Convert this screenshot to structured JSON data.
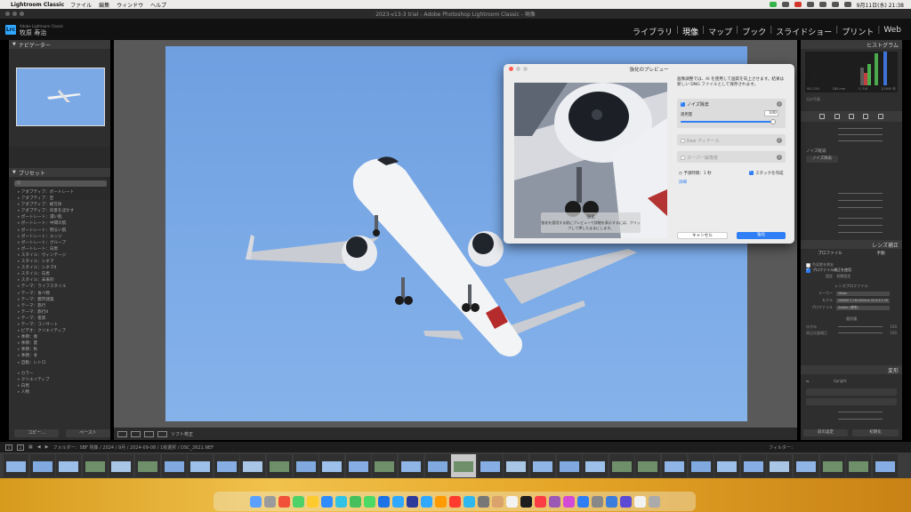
{
  "menubar": {
    "app_name": "Lightroom Classic",
    "items": [
      "ファイル",
      "編集",
      "ウィンドウ",
      "ヘルプ"
    ],
    "clock": "9月11日(水) 21:38"
  },
  "window_title": "2023-v13-3 trial - Adobe Photoshop Lightroom Classic - 現像",
  "identity": {
    "badge": "Lrc",
    "sub": "Adobe Lightroom Classic",
    "name": "牧原 寿治"
  },
  "modules": [
    "ライブラリ",
    "現像",
    "マップ",
    "ブック",
    "スライドショー",
    "プリント",
    "Web"
  ],
  "modules_active": "現像",
  "left_panel": {
    "navigator_title": "ナビゲーター",
    "presets_title": "プリセット",
    "search_placeholder": "Q",
    "presets": [
      "アダプティブ：ポートレート",
      "アダプティブ：空",
      "アダプティブ：被写体",
      "アダプティブ：背景をぼかす",
      "ポートレート：濃い肌",
      "ポートレート：中間の肌",
      "ポートレート：明るい肌",
      "ポートレート：エッジ",
      "ポートレート：グループ",
      "ポートレート：白黒",
      "スタイル：ヴィンテージ",
      "スタイル：シネマ",
      "スタイル：シネマII",
      "スタイル：白黒",
      "スタイル：未来的",
      "テーマ：ライフスタイル",
      "テーマ：食べ物",
      "テーマ：都市建築",
      "テーマ：旅行",
      "テーマ：旅行II",
      "テーマ：夜景",
      "テーマ：コンサート",
      "ビデオ：クリエイティブ",
      "季節：春",
      "季節：夏",
      "季節：秋",
      "季節：冬",
      "自動：レトロ",
      "カラー",
      "クリエイティブ",
      "白黒",
      "人物"
    ],
    "copy_button": "コピー...",
    "paste_button": "ペースト"
  },
  "toolbar": {
    "soft_proof_label": "ソフト校正"
  },
  "right_panel": {
    "histogram_title": "ヒストグラム",
    "original_photo_label": "元の写真",
    "histogram_stats": [
      "ISO 250",
      "180 mm",
      "f / 5.6",
      "1/1600 秒"
    ],
    "noise_label": "ノイズ軽減",
    "noise_button": "ノイズ除去",
    "lens_title": "レンズ補正",
    "lens_tabs": [
      "プロファイル",
      "手動"
    ],
    "lens_options": [
      "色収差を除去",
      "プロファイル補正を使用"
    ],
    "lens_setup_label": "設定",
    "lens_setup_value": "初期設定",
    "lens_profile_section": "レンズプロファイル",
    "lens_maker_label": "メーカー",
    "lens_maker_value": "Nikon",
    "lens_model_label": "モデル",
    "lens_model_value": "NIKKOR Z 180-600mm f/5.6-6.3 VR",
    "lens_profile_label": "プロファイル",
    "lens_profile_value": "Adobe (標準)",
    "amount_section": "適用量",
    "distortion_label": "ゆがみ",
    "vignette_label": "周辺光量補正",
    "distortion_value": "100",
    "vignette_value": "100",
    "transform_title": "変形",
    "upright_label": "Upright",
    "reset_prev_button": "前の設定",
    "reset_button": "初期化"
  },
  "filmstrip": {
    "pages": [
      "1",
      "2"
    ],
    "path": "フォルダー：SBF  現像 / 2024 / 9月 / 2024-09-08 / 1枚選択 / DSC_2621.NEF",
    "filter_label": "フィルター："
  },
  "dialog": {
    "title": "強化のプレビュー",
    "description": "画像調整では、AI を使用して画質を向上させます。結果は新しい DNG ファイルとして保存されます。",
    "noise_label": "ノイズ除去",
    "amount_label": "適用量",
    "amount_value": "100",
    "amount_fraction": 1.0,
    "raw_detail_label": "Raw ディテール",
    "super_res_label": "スーパー解像度",
    "estimate_label": "予測時間：1 秒",
    "stack_label": "スタックを作成",
    "details_link": "詳細",
    "overlay_title": "強化",
    "overlay_text": "強化を適用する前にプレビューで詳細を表示するには、クリックして押したままにします。",
    "cancel_button": "キャンセル",
    "ok_button": "強化"
  },
  "colors": {
    "accent_blue": "#2f7ef5",
    "sky": "#7aa9e6",
    "panel_bg": "#2e2e2e",
    "lrc_blue": "#31a8ff"
  }
}
